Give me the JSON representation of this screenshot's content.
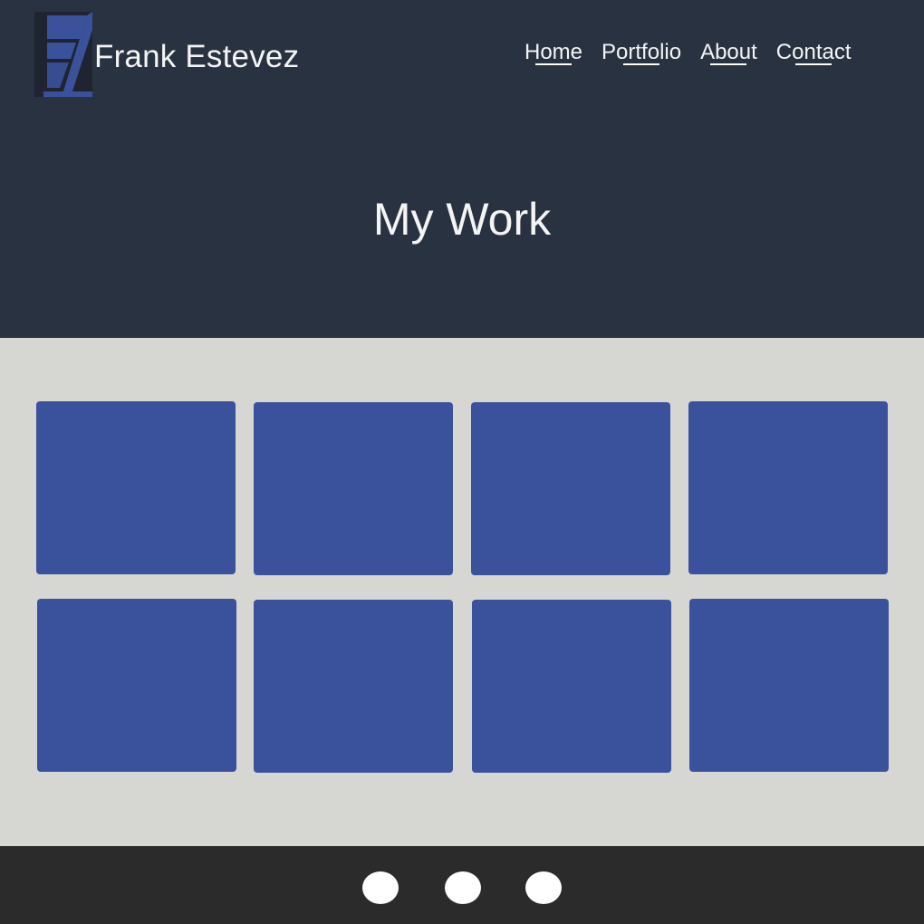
{
  "brand": {
    "name": "Frank Estevez",
    "logo_icon": "fe-monogram-logo-icon"
  },
  "nav": [
    {
      "label": "Home"
    },
    {
      "label": "Portfolio"
    },
    {
      "label": "About"
    },
    {
      "label": "Contact"
    }
  ],
  "hero": {
    "title": "My Work"
  },
  "portfolio": {
    "tile_count": 8
  },
  "footer": {
    "social_icons": [
      "social-icon-1",
      "social-icon-2",
      "social-icon-3"
    ]
  },
  "colors": {
    "header_bg": "#293241",
    "content_bg": "#d6d6d2",
    "tile_blue": "#3a529c",
    "footer_bg": "#2b2b2b",
    "text_light": "#f4f4f4"
  }
}
